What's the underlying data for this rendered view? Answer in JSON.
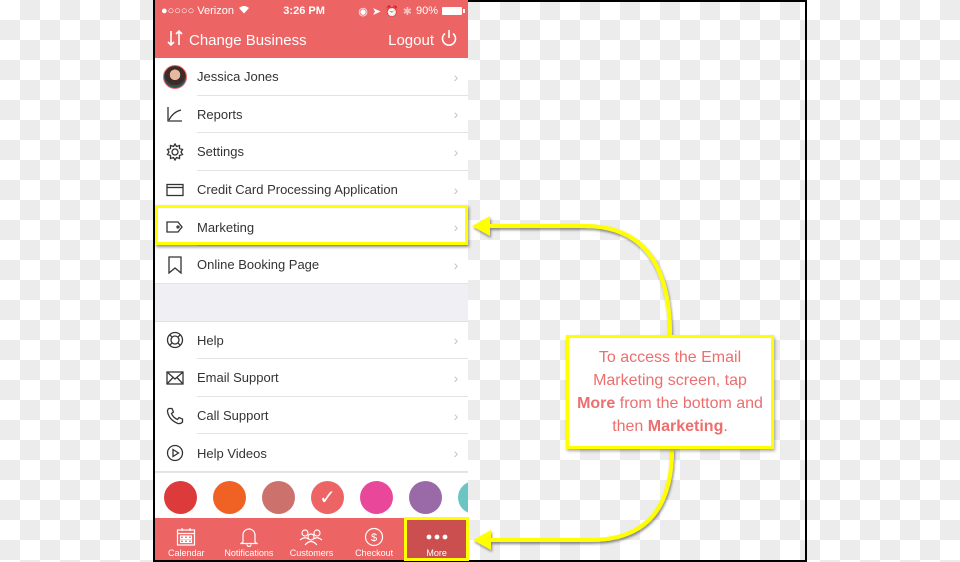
{
  "status_bar": {
    "carrier": "●○○○○ Verizon",
    "time": "3:26 PM",
    "battery": "90%"
  },
  "header": {
    "change_business": "Change Business",
    "logout": "Logout"
  },
  "menu": {
    "group1": [
      {
        "label": "Jessica Jones",
        "icon": "avatar"
      },
      {
        "label": "Reports",
        "icon": "chart-icon"
      },
      {
        "label": "Settings",
        "icon": "gear-icon"
      },
      {
        "label": "Credit Card Processing Application",
        "icon": "credit-card-icon"
      },
      {
        "label": "Marketing",
        "icon": "tag-icon"
      },
      {
        "label": "Online Booking Page",
        "icon": "bookmark-icon"
      }
    ],
    "group2": [
      {
        "label": "Help",
        "icon": "lifebuoy-icon"
      },
      {
        "label": "Email Support",
        "icon": "envelope-icon"
      },
      {
        "label": "Call Support",
        "icon": "phone-icon"
      },
      {
        "label": "Help Videos",
        "icon": "play-icon"
      }
    ]
  },
  "theme_colors": [
    "#dd3b3b",
    "#f06224",
    "#cc716c",
    "#ec6464",
    "#e9479a",
    "#9a6aa8",
    "#6cc5c2"
  ],
  "selected_color_index": 3,
  "tabbar": {
    "tabs": [
      {
        "label": "Calendar",
        "icon": "calendar-icon"
      },
      {
        "label": "Notifications",
        "icon": "bell-icon"
      },
      {
        "label": "Customers",
        "icon": "people-icon"
      },
      {
        "label": "Checkout",
        "icon": "dollar-icon"
      },
      {
        "label": "More",
        "icon": "more-icon"
      }
    ],
    "active": "More"
  },
  "callout": {
    "line1": "To access the Email Marketing screen, tap",
    "bold1": "More",
    "line2": "from the bottom and then",
    "bold2": "Marketing",
    "end": "."
  },
  "colors": {
    "brand": "#ec6464",
    "highlight": "#ffff00",
    "callout_text": "#ec6e6e"
  }
}
